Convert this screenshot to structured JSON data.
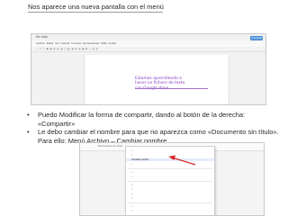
{
  "heading": "Nos aparece una nueva pantalla con el menú",
  "screenshot_top": {
    "doc_title": "Sin título",
    "menu_items": [
      "Archivo",
      "Editar",
      "Ver",
      "Insertar",
      "Formato",
      "Herramientas",
      "Tabla",
      "Ayuda"
    ],
    "share_button": "Compartir",
    "note_text": "Estamos aprendiendo a hacer un fichero de texto con Google drive"
  },
  "bullets": [
    "Puedo Modificar la forma de compartir, dando al botón de la derecha: «Compartir»",
    "Le debo cambiar el nombre para que no aparezca como «Documento sin título». Para ello: Menú Archivo – Cambiar nombre"
  ],
  "screenshot_bottom": {
    "doc_title": "Documento sin título",
    "highlighted_item": "Cambiar nombre"
  },
  "colors": {
    "note_text": "#8a3cc2",
    "share_button": "#4d8fd8",
    "arrow": "#d42a2a"
  }
}
